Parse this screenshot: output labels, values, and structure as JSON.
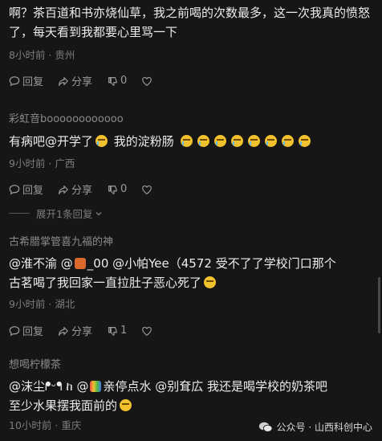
{
  "comments": [
    {
      "username": "",
      "text": "啊？茶百道和书亦烧仙草，我之前喝的次数最多，这一次我真的愤怒了，每天看到我都要心里骂一下",
      "meta": "8小时前 · 贵州",
      "reply_label": "回复",
      "share_label": "分享",
      "like_count": "0"
    },
    {
      "username": "彩虹音boooooooooooo",
      "text_prefix": "有病吧@开学了",
      "text_suffix": " 我的淀粉肠",
      "meta": "9小时前 · 广西",
      "reply_label": "回复",
      "share_label": "分享",
      "like_count": "0"
    },
    {
      "username": "古希腊掌管喜九福的神",
      "text_line1_a": "@淮不渝 @",
      "text_line1_b": "_00 @小帕Yee（4572 受不了了学校门口那个",
      "text_line2": "古茗喝了我回家一直拉肚子恶心死了",
      "meta": "9小时前 · 湖北",
      "reply_label": "回复",
      "share_label": "分享",
      "like_count": "1"
    },
    {
      "username": "想喝柠檬茶",
      "text_line1_a": "@沫尘ᖰᵕᖳ ከ @",
      "text_line1_b": "亲停点水 @别耷広 我还是喝学校的奶茶吧",
      "text_line2": "至少水果摆我面前的",
      "meta": "10小时前 · 重庆"
    }
  ],
  "expand_replies": "展开1条回复",
  "watermark": "公众号 · 山西科创中心",
  "colors": {
    "background": "#161616",
    "emoji": "#f2c12e"
  },
  "icons": [
    "comment-icon",
    "share-icon",
    "thumbs-down-icon",
    "heart-icon",
    "crying-emoji",
    "laughing-emoji",
    "wechat-icon"
  ]
}
